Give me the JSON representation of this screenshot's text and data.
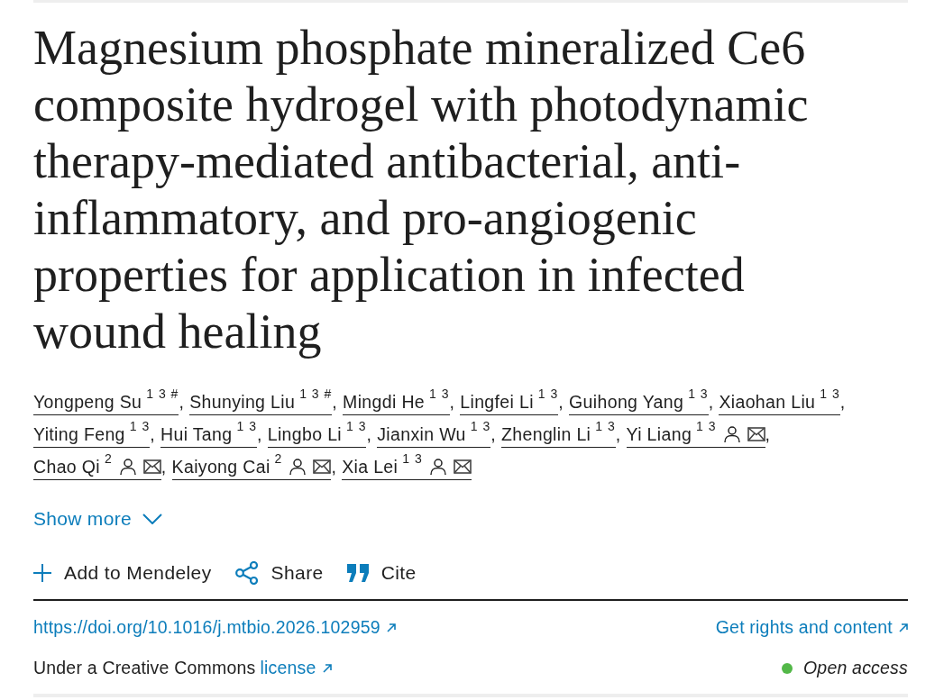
{
  "title": "Magnesium phosphate mineralized Ce6 composite hydrogel with photodynamic therapy-mediated antibacterial, anti-inflammatory, and pro-angiogenic properties for application in infected wound healing",
  "authors": [
    {
      "name": "Yongpeng Su",
      "affiliations": "1 3 #",
      "corresponding": false,
      "separator": ","
    },
    {
      "name": "Shunying Liu",
      "affiliations": "1 3 #",
      "corresponding": false,
      "separator": ","
    },
    {
      "name": "Mingdi He",
      "affiliations": "1 3",
      "corresponding": false,
      "separator": ","
    },
    {
      "name": "Lingfei Li",
      "affiliations": "1 3",
      "corresponding": false,
      "separator": ","
    },
    {
      "name": "Guihong Yang",
      "affiliations": "1 3",
      "corresponding": false,
      "separator": ","
    },
    {
      "name": "Xiaohan Liu",
      "affiliations": "1 3",
      "corresponding": false,
      "separator": ","
    },
    {
      "name": "Yiting Feng",
      "affiliations": "1 3",
      "corresponding": false,
      "separator": ","
    },
    {
      "name": "Hui Tang",
      "affiliations": "1 3",
      "corresponding": false,
      "separator": ","
    },
    {
      "name": "Lingbo Li",
      "affiliations": "1 3",
      "corresponding": false,
      "separator": ","
    },
    {
      "name": "Jianxin Wu",
      "affiliations": "1 3",
      "corresponding": false,
      "separator": ","
    },
    {
      "name": "Zhenglin Li",
      "affiliations": "1 3",
      "corresponding": false,
      "separator": ","
    },
    {
      "name": "Yi Liang",
      "affiliations": "1 3",
      "corresponding": true,
      "separator": ","
    },
    {
      "name": "Chao Qi",
      "affiliations": "2",
      "corresponding": true,
      "separator": ","
    },
    {
      "name": "Kaiyong Cai",
      "affiliations": "2",
      "corresponding": true,
      "separator": ","
    },
    {
      "name": "Xia Lei",
      "affiliations": "1 3",
      "corresponding": true
    }
  ],
  "show_more": {
    "label": "Show more",
    "expanded": false
  },
  "actions": [
    {
      "kind": "add",
      "label": "Add to Mendeley"
    },
    {
      "kind": "share",
      "label": "Share"
    },
    {
      "kind": "cite",
      "label": "Cite"
    }
  ],
  "doi_link": "https://doi.org/10.1016/j.mtbio.2026.102959",
  "rights_link": "Get rights and content",
  "license": {
    "text": "Under a Creative Commons",
    "link": "license"
  },
  "access": {
    "label": "Open access"
  }
}
